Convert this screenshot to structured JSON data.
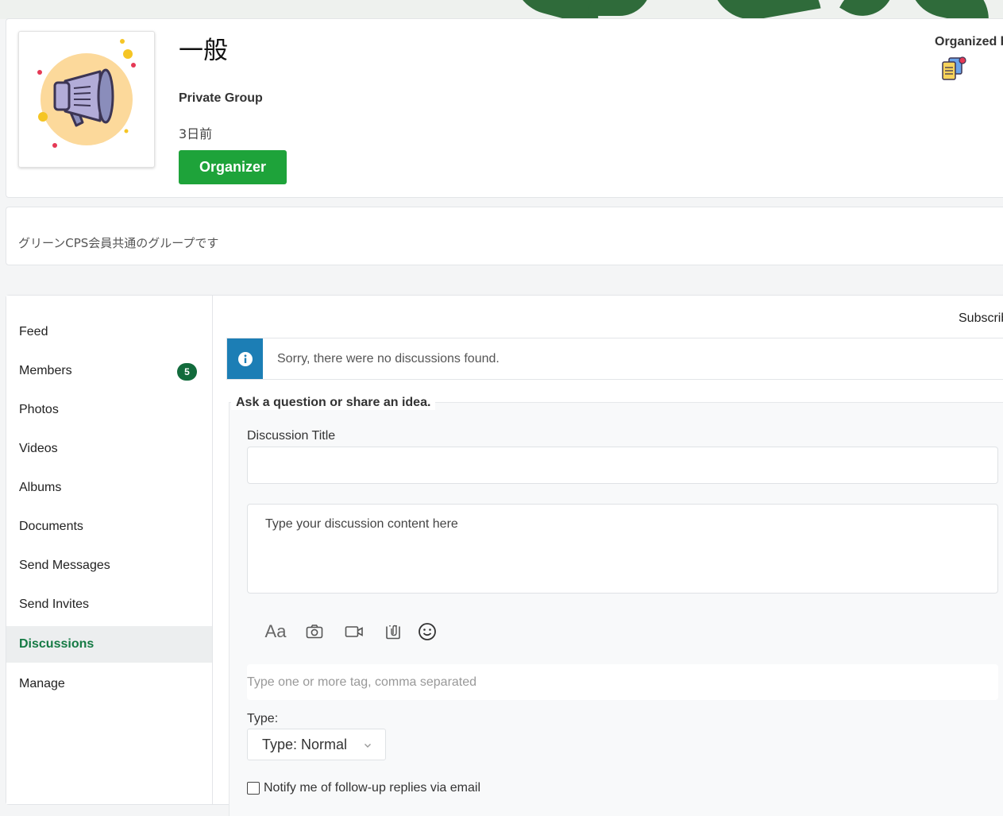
{
  "group": {
    "name": "一般",
    "privacy": "Private Group",
    "time_ago": "3日前",
    "role_button": "Organizer",
    "organized_label": "Organized by"
  },
  "description": "グリーンCPS会員共通のグループです",
  "sidebar": {
    "items": [
      {
        "label": "Feed"
      },
      {
        "label": "Members",
        "badge": "5"
      },
      {
        "label": "Photos"
      },
      {
        "label": "Videos"
      },
      {
        "label": "Albums"
      },
      {
        "label": "Documents"
      },
      {
        "label": "Send Messages"
      },
      {
        "label": "Send Invites"
      },
      {
        "label": "Discussions",
        "active": true
      },
      {
        "label": "Manage"
      }
    ]
  },
  "discussions": {
    "subscribe_label": "Subscribe",
    "empty_notice": "Sorry, there were no discussions found.",
    "form": {
      "legend": "Ask a question or share an idea.",
      "title_label": "Discussion Title",
      "title_value": "",
      "content_placeholder": "Type your discussion content here",
      "toolbar_icons": [
        "text-format-icon",
        "camera-icon",
        "video-icon",
        "attachment-icon",
        "emoji-icon"
      ],
      "text_format_glyph": "Aa",
      "tags_placeholder": "Type one or more tag, comma separated",
      "type_label": "Type:",
      "type_value": "Type: Normal",
      "notify_label": "Notify me of follow-up replies via email",
      "notify_checked": false
    }
  },
  "colors": {
    "organizer_button": "#1ea33a",
    "active_nav_text": "#157a44",
    "badge_bg": "#126b3c",
    "info_icon_bg": "#1c7eb5"
  }
}
